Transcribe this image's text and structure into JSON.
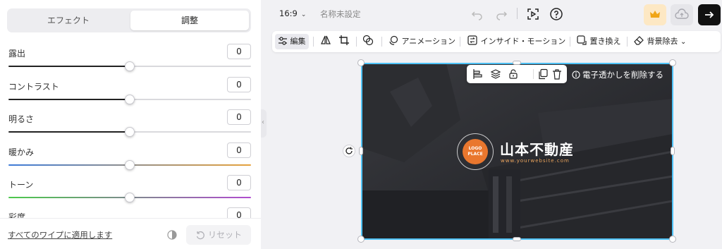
{
  "panel": {
    "tabs": [
      {
        "label": "エフェクト",
        "active": false
      },
      {
        "label": "調整",
        "active": true
      }
    ],
    "sliders": [
      {
        "label": "露出",
        "value": "0",
        "level": 0.5,
        "track_color": "#d9d9dd"
      },
      {
        "label": "コントラスト",
        "value": "0",
        "level": 0.5,
        "track_color": "#d9d9dd"
      },
      {
        "label": "明るさ",
        "value": "0",
        "level": 0.5,
        "track_color": "#d9d9dd"
      },
      {
        "label": "暖かみ",
        "value": "0",
        "level": 0.5,
        "track_color": "linear-gradient(90deg,#3d7bd9,#e6a23c)"
      },
      {
        "label": "トーン",
        "value": "0",
        "level": 0.5,
        "track_color": "linear-gradient(90deg,#4cc94c,#b04ccf)"
      },
      {
        "label": "彩度",
        "value": "0",
        "level": 0.5,
        "track_color": "#d9d9dd"
      }
    ],
    "apply_all": "すべてのワイプに適用します",
    "reset": "リセット"
  },
  "topbar": {
    "ratio": "16:9",
    "doc_name": "名称未設定"
  },
  "toolbar": {
    "edit": "編集",
    "animation": "アニメーション",
    "inside_motion": "インサイド・モーション",
    "replace": "置き換え",
    "remove_bg": "背景除去"
  },
  "canvas": {
    "watermark_remove": "電子透かしを削除する",
    "logo_text_1": "LOGO",
    "logo_text_2": "PLACE",
    "company_name": "山本不動産",
    "company_url": "www.yourwebsite.com"
  },
  "colors": {
    "accent": "#4fc3f7",
    "logo": "#e9772e",
    "crown": "#f0a516"
  }
}
